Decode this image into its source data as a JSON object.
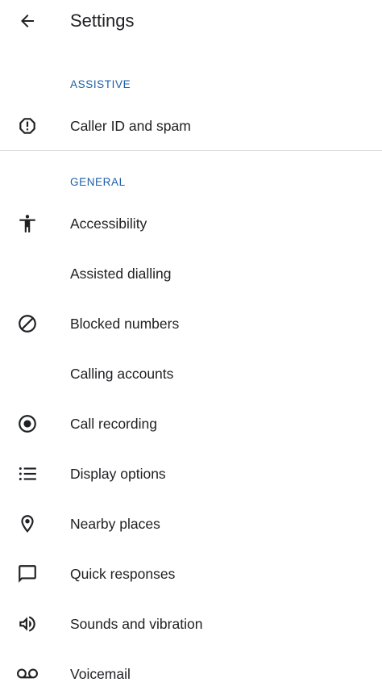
{
  "header": {
    "title": "Settings",
    "back_icon": "arrow-back-icon"
  },
  "sections": {
    "assistive": {
      "title": "ASSISTIVE",
      "items": [
        {
          "label": "Caller ID and spam",
          "icon": "caller-id-spam-icon"
        }
      ]
    },
    "general": {
      "title": "GENERAL",
      "items": [
        {
          "label": "Accessibility",
          "icon": "accessibility-icon"
        },
        {
          "label": "Assisted dialling",
          "icon": ""
        },
        {
          "label": "Blocked numbers",
          "icon": "blocked-icon"
        },
        {
          "label": "Calling accounts",
          "icon": ""
        },
        {
          "label": "Call recording",
          "icon": "record-icon"
        },
        {
          "label": "Display options",
          "icon": "list-icon"
        },
        {
          "label": "Nearby places",
          "icon": "location-pin-icon"
        },
        {
          "label": "Quick responses",
          "icon": "chat-bubble-icon"
        },
        {
          "label": "Sounds and vibration",
          "icon": "speaker-icon"
        },
        {
          "label": "Voicemail",
          "icon": "voicemail-icon"
        }
      ]
    }
  },
  "colors": {
    "section_header": "#1a5fa8",
    "text": "#202124",
    "icon": "#202124",
    "divider": "#dadce0",
    "background": "#ffffff"
  }
}
